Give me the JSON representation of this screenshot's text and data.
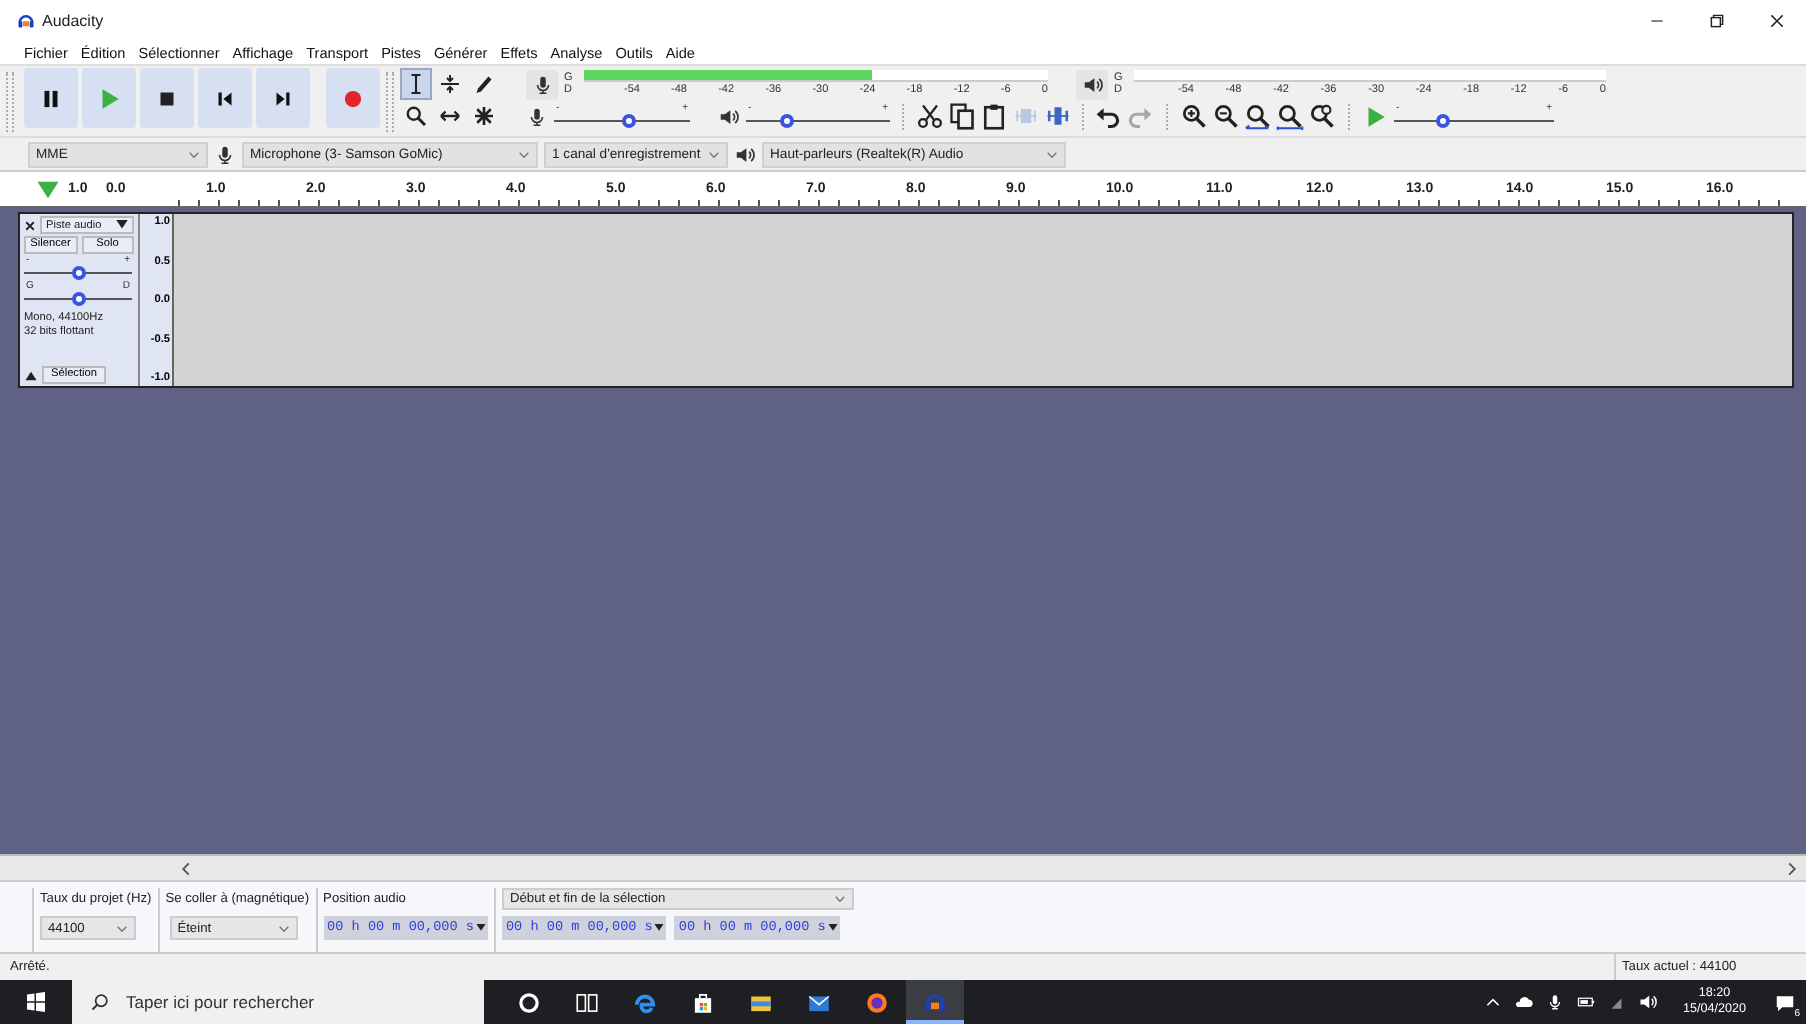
{
  "window": {
    "title": "Audacity"
  },
  "menu": [
    "Fichier",
    "Édition",
    "Sélectionner",
    "Affichage",
    "Transport",
    "Pistes",
    "Générer",
    "Effets",
    "Analyse",
    "Outils",
    "Aide"
  ],
  "tools": [
    {
      "kind": "selection",
      "selected": true
    },
    {
      "kind": "envelope",
      "selected": false
    },
    {
      "kind": "draw",
      "selected": false
    },
    {
      "kind": "zoom",
      "selected": false
    },
    {
      "kind": "timeshift",
      "selected": false
    },
    {
      "kind": "multi",
      "selected": false
    }
  ],
  "meters": [
    {
      "kind": "record",
      "channels": [
        "G",
        "D"
      ],
      "ticks": [
        "-54",
        "-48",
        "-42",
        "-36",
        "-30",
        "-24",
        "-18",
        "-12",
        "-6",
        "0"
      ],
      "level": 0.62
    },
    {
      "kind": "playback",
      "channels": [
        "G",
        "D"
      ],
      "ticks": [
        "-54",
        "-48",
        "-42",
        "-36",
        "-30",
        "-24",
        "-18",
        "-12",
        "-6",
        "0"
      ]
    }
  ],
  "mixer": [
    {
      "kind": "record",
      "min_label": "-",
      "max_label": "+",
      "level": 0.55
    },
    {
      "kind": "playback",
      "min_label": "-",
      "max_label": "+",
      "level": 0.28
    }
  ],
  "edit_tools": [
    {
      "kind": "cut",
      "disabled": false
    },
    {
      "kind": "copy",
      "disabled": false
    },
    {
      "kind": "paste",
      "disabled": false
    },
    {
      "kind": "trim",
      "disabled": true
    },
    {
      "kind": "silence",
      "disabled": false
    },
    {
      "kind": "undo",
      "disabled": false
    },
    {
      "kind": "redo",
      "disabled": true
    }
  ],
  "play_at_speed": {
    "min_label": "-",
    "max_label": "+",
    "level": 0.3
  },
  "devices": {
    "host": "MME",
    "microphone": "Microphone (3- Samson GoMic)",
    "channels": "1 canal d'enregistrement",
    "speakers": "Haut-parleurs (Realtek(R) Audio"
  },
  "ruler": {
    "ticks": [
      "1.0",
      "0.0",
      "1.0",
      "2.0",
      "3.0",
      "4.0",
      "5.0",
      "6.0",
      "7.0",
      "8.0",
      "9.0",
      "10.0",
      "11.0",
      "12.0",
      "13.0",
      "14.0",
      "15.0",
      "16.0"
    ]
  },
  "tracks": [
    {
      "name": "Piste audio",
      "buttons": [
        "Silencer",
        "Solo"
      ],
      "gain": {
        "min_label": "-",
        "max_label": "+",
        "level": 0.5
      },
      "pan": {
        "min_label": "G",
        "max_label": "D",
        "level": 0.5
      },
      "info": [
        "Mono, 44100Hz",
        "32 bits flottant"
      ],
      "select_button": "Sélection",
      "scale": [
        "1.0",
        "0.5",
        "0.0",
        "-0.5",
        "-1.0"
      ]
    }
  ],
  "selection_toolbar": {
    "rate": {
      "label": "Taux du projet (Hz)",
      "value": "44100"
    },
    "snap": {
      "label": "Se coller à (magnétique)",
      "value": "Éteint"
    },
    "position": {
      "label": "Position audio",
      "value": "00 h 00 m 00,000 s"
    },
    "selection": {
      "label": "Début et fin de la sélection",
      "start": "00 h 00 m 00,000 s",
      "end": "00 h 00 m 00,000 s"
    }
  },
  "status_bar": {
    "state": "Arrêté.",
    "rate": "Taux actuel : 44100"
  },
  "taskbar": {
    "search_placeholder": "Taper ici pour rechercher",
    "time": "18:20",
    "date": "15/04/2020",
    "notifications": "6"
  }
}
